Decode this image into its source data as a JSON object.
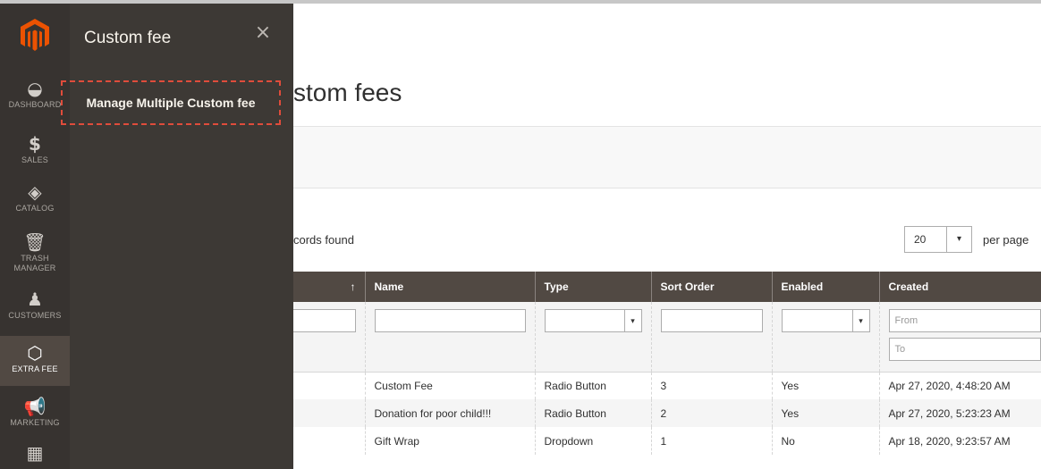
{
  "rail": {
    "items": [
      {
        "label": "DASHBOARD",
        "icon": "dashboard-icon",
        "glyph": "◒"
      },
      {
        "label": "SALES",
        "icon": "dollar-icon",
        "glyph": "$"
      },
      {
        "label": "CATALOG",
        "icon": "cube-icon",
        "glyph": "◈"
      },
      {
        "label": "TRASH MANAGER",
        "icon": "trash-icon",
        "glyph": "🗑"
      },
      {
        "label": "CUSTOMERS",
        "icon": "person-icon",
        "glyph": "♟"
      },
      {
        "label": "EXTRA FEE",
        "icon": "hexagon-icon",
        "glyph": "⬡"
      },
      {
        "label": "MARKETING",
        "icon": "megaphone-icon",
        "glyph": "📢"
      },
      {
        "label": "",
        "icon": "layout-icon",
        "glyph": "▦"
      }
    ]
  },
  "submenu": {
    "title": "Custom fee",
    "close_glyph": "×",
    "link": "Manage Multiple Custom fee"
  },
  "main": {
    "title": "stom fees",
    "records_text": "cords found",
    "per_page_value": "20",
    "per_page_arrow": "▾",
    "per_page_label": "per page"
  },
  "grid": {
    "columns": [
      "↑",
      "Name",
      "Type",
      "Sort Order",
      "Enabled",
      "Created"
    ],
    "filters": {
      "created_from": "From",
      "created_to": "To",
      "select_arrow": "▾"
    },
    "rows": [
      {
        "name": "Custom Fee",
        "type": "Radio Button",
        "sort_order": "3",
        "enabled": "Yes",
        "created": "Apr 27, 2020, 4:48:20 AM"
      },
      {
        "name": "Donation for poor child!!!",
        "type": "Radio Button",
        "sort_order": "2",
        "enabled": "Yes",
        "created": "Apr 27, 2020, 5:23:23 AM"
      },
      {
        "name": "Gift Wrap",
        "type": "Dropdown",
        "sort_order": "1",
        "enabled": "No",
        "created": "Apr 18, 2020, 9:23:57 AM"
      }
    ]
  },
  "colors": {
    "rail_bg": "#373330",
    "submenu_bg": "#3d3935",
    "grid_header_bg": "#514943",
    "logo_orange": "#eb5202",
    "highlight_dash": "#e04c3b"
  }
}
